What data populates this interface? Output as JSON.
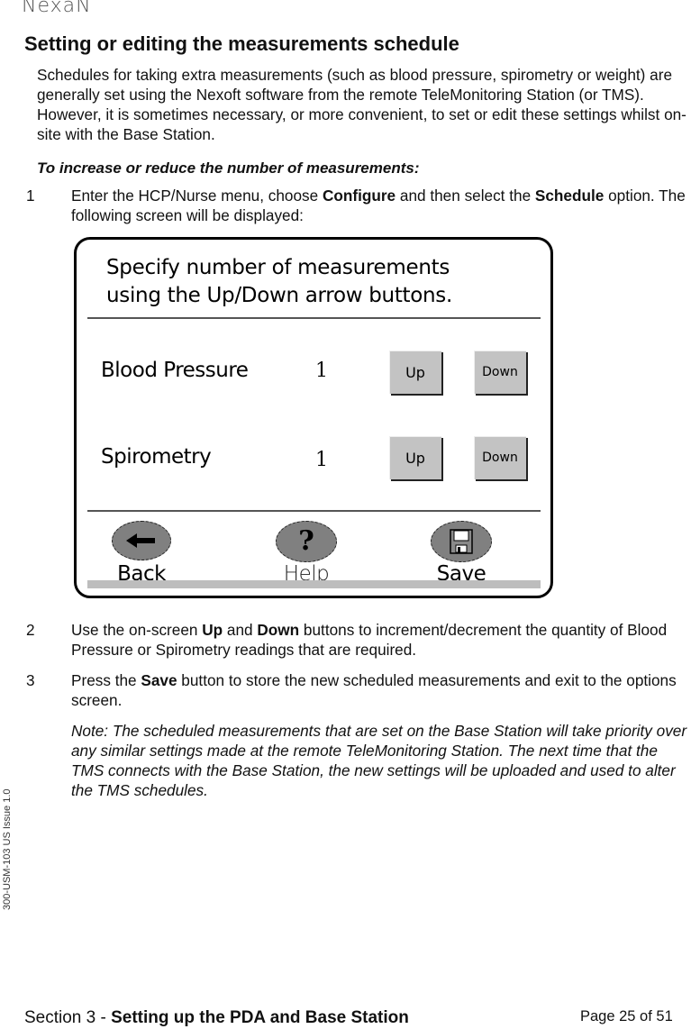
{
  "header": {
    "logo": "NexaN"
  },
  "page_title": "Setting or editing the measurements schedule",
  "intro": "Schedules for taking extra measurements (such as blood pressure, spirometry or weight) are generally set using the Nexoft software from the remote TeleMonitoring Station (or TMS). However, it is sometimes necessary, or more convenient, to set or edit these settings whilst on-site with the Base Station.",
  "subheading": "To increase or reduce the number of measurements:",
  "steps": [
    {
      "num": "1",
      "parts": [
        "Enter the HCP/Nurse menu, choose ",
        "Configure",
        " and then select the ",
        "Schedule",
        " option. The following screen will be displayed:"
      ]
    },
    {
      "num": "2",
      "parts": [
        "Use the on-screen ",
        "Up",
        " and ",
        "Down",
        " buttons to increment/decrement the quantity of Blood Pressure or Spirometry readings that are required."
      ]
    },
    {
      "num": "3",
      "parts": [
        "Press the ",
        "Save",
        " button to store the new scheduled measurements and exit to the options screen."
      ]
    }
  ],
  "note": "Note: The scheduled measurements that are set on the Base Station will take priority over any similar settings made at the remote TeleMonitoring Station. The next time that the TMS connects with the Base Station, the new settings will be uploaded and used to alter the TMS schedules.",
  "device_screen": {
    "title_line1": "Specify number of measurements",
    "title_line2": "using the Up/Down arrow buttons.",
    "rows": [
      {
        "label": "Blood Pressure",
        "value": "1",
        "up": "Up",
        "down": "Down"
      },
      {
        "label": "Spirometry",
        "value": "1",
        "up": "Up",
        "down": "Down"
      }
    ],
    "nav": [
      {
        "label": "Back",
        "icon": "back-arrow-icon"
      },
      {
        "label": "Help",
        "icon": "question-mark-icon"
      },
      {
        "label": "Save",
        "icon": "floppy-disk-icon"
      }
    ]
  },
  "sidebar_doc_id": "300-USM-103 US Issue 1.0",
  "footer": {
    "section_prefix": "Section 3 - ",
    "section_title": "Setting up the PDA and Base Station",
    "page": "Page 25 of 51"
  }
}
